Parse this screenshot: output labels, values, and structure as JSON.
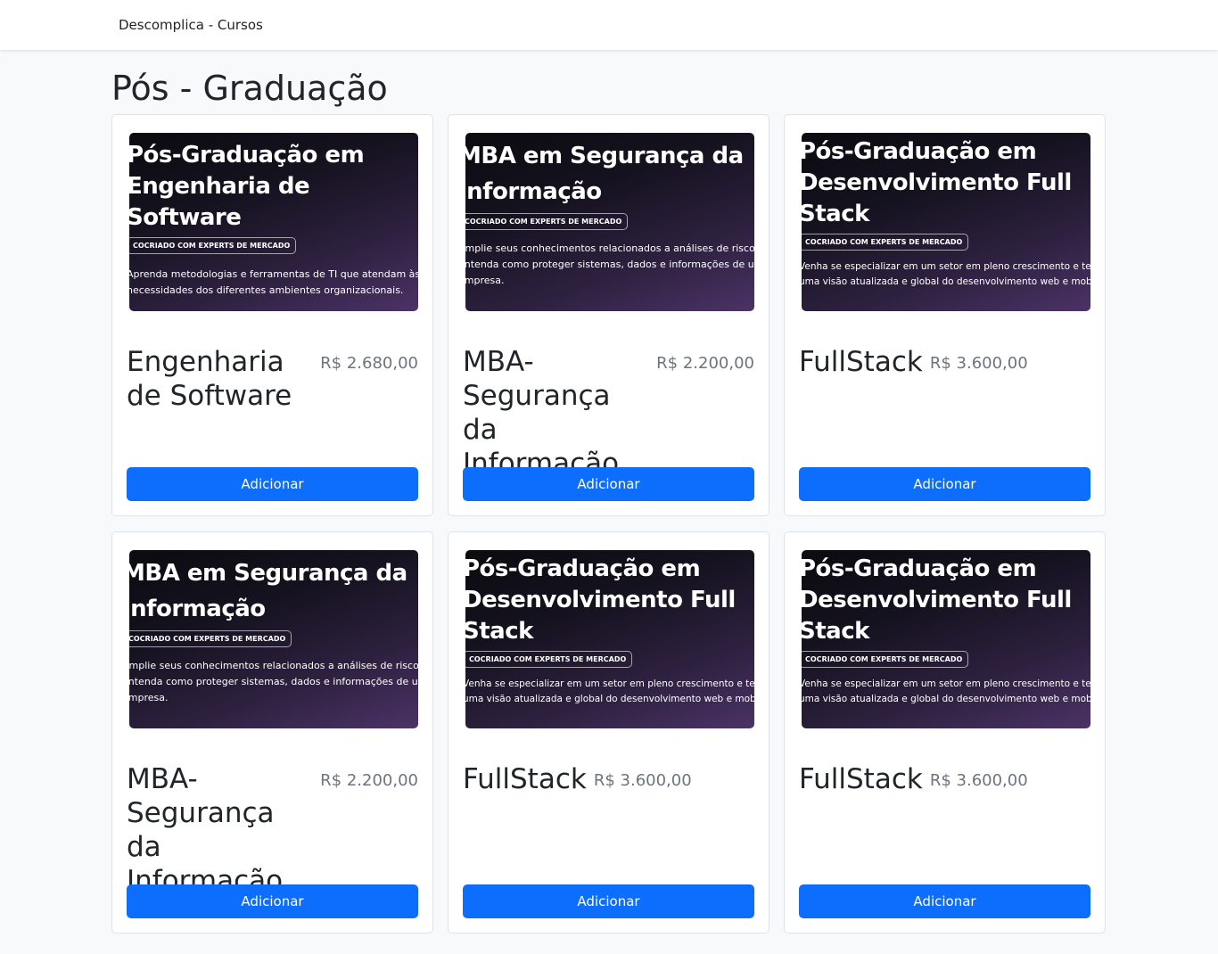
{
  "navbar": {
    "brand": "Descomplica - Cursos"
  },
  "page": {
    "title": "Pós - Graduação"
  },
  "cards": [
    {
      "banner": {
        "title_lines": [
          "Pós-Graduação em",
          "Engenharia de",
          "Software"
        ],
        "badge": "COCRIADO COM EXPERTS DE MERCADO",
        "desc_lines": [
          "Aprenda metodologias e ferramentas de TI que atendam às atuais",
          "necessidades dos diferentes ambientes organizacionais."
        ]
      },
      "name": "Engenharia de Software",
      "price": "R$ 2.680,00",
      "button": "Adicionar"
    },
    {
      "banner": {
        "title_lines": [
          "MBA em Segurança da",
          "Informação"
        ],
        "badge": "COCRIADO COM EXPERTS DE MERCADO",
        "desc_lines": [
          "Amplie seus conhecimentos relacionados a análises de riscos e",
          "entenda como proteger sistemas, dados e informações de uma",
          "empresa."
        ]
      },
      "name": "MBA- Segurança da Informação",
      "price": "R$ 2.200,00",
      "button": "Adicionar"
    },
    {
      "banner": {
        "title_lines": [
          "Pós-Graduação em",
          "Desenvolvimento Full",
          "Stack"
        ],
        "badge": "COCRIADO COM EXPERTS DE MERCADO",
        "desc_lines": [
          "Venha se especializar em um setor em pleno crescimento e tenha",
          "uma visão atualizada e global do desenvolvimento web e mobile."
        ]
      },
      "name": "FullStack",
      "price": "R$ 3.600,00",
      "button": "Adicionar"
    },
    {
      "banner": {
        "title_lines": [
          "MBA em Segurança da",
          "Informação"
        ],
        "badge": "COCRIADO COM EXPERTS DE MERCADO",
        "desc_lines": [
          "Amplie seus conhecimentos relacionados a análises de riscos e",
          "entenda como proteger sistemas, dados e informações de uma",
          "empresa."
        ]
      },
      "name": "MBA- Segurança da Informação",
      "price": "R$ 2.200,00",
      "button": "Adicionar"
    },
    {
      "banner": {
        "title_lines": [
          "Pós-Graduação em",
          "Desenvolvimento Full",
          "Stack"
        ],
        "badge": "COCRIADO COM EXPERTS DE MERCADO",
        "desc_lines": [
          "Venha se especializar em um setor em pleno crescimento e tenha",
          "uma visão atualizada e global do desenvolvimento web e mobile."
        ]
      },
      "name": "FullStack",
      "price": "R$ 3.600,00",
      "button": "Adicionar"
    },
    {
      "banner": {
        "title_lines": [
          "Pós-Graduação em",
          "Desenvolvimento Full",
          "Stack"
        ],
        "badge": "COCRIADO COM EXPERTS DE MERCADO",
        "desc_lines": [
          "Venha se especializar em um setor em pleno crescimento e tenha",
          "uma visão atualizada e global do desenvolvimento web e mobile."
        ]
      },
      "name": "FullStack",
      "price": "R$ 3.600,00",
      "button": "Adicionar"
    }
  ]
}
